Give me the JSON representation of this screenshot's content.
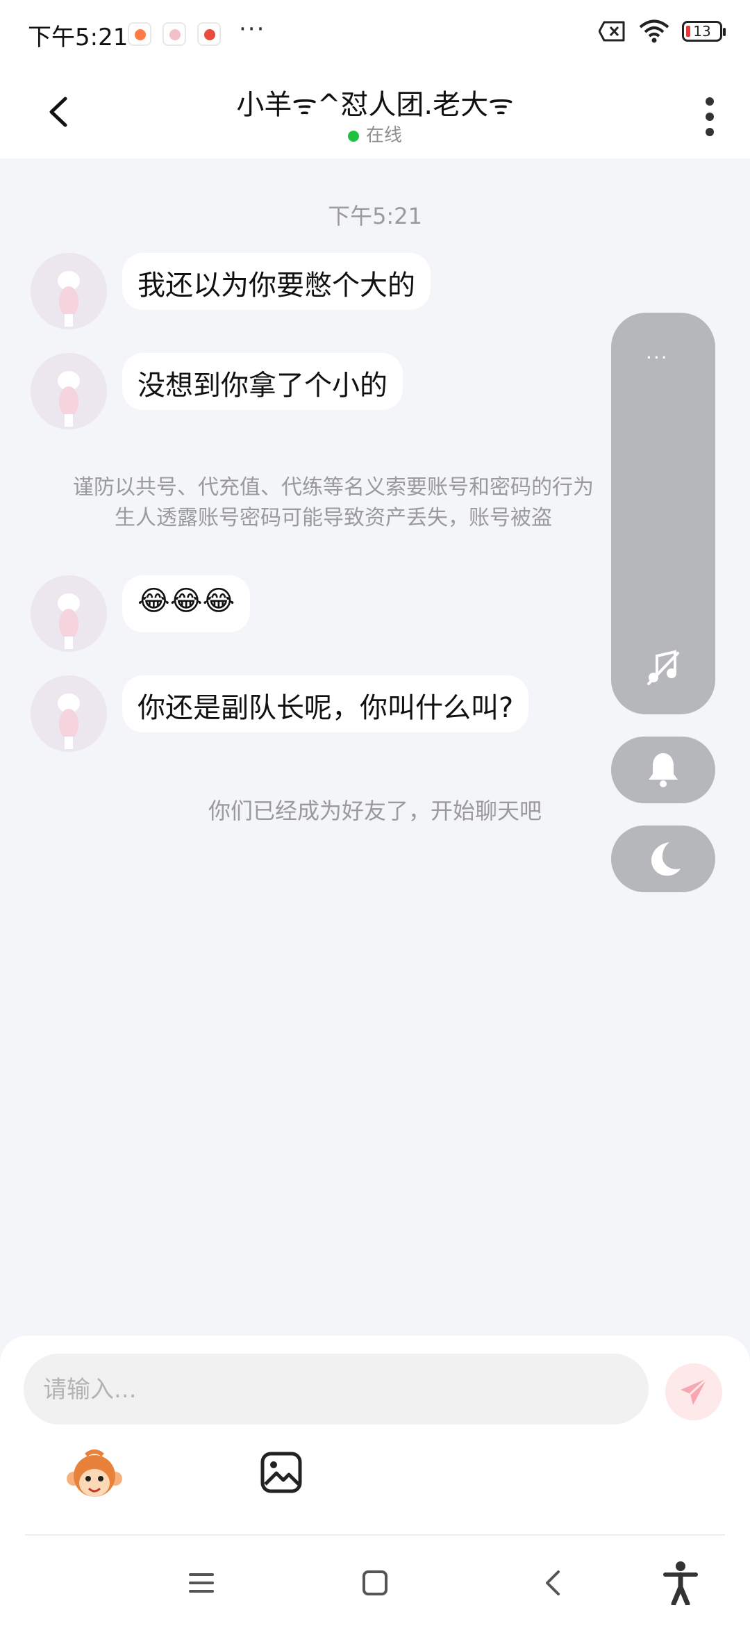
{
  "status": {
    "time": "下午5:21",
    "more": "···",
    "battery": "13"
  },
  "header": {
    "title": "小羊ᯤ^怼人团.老大ᯤ",
    "status": "在线"
  },
  "chat": {
    "timestamp": "下午5:21",
    "messages": [
      {
        "text": "我还以为你要憋个大的"
      },
      {
        "text": "没想到你拿了个小的"
      },
      {
        "text": "😂😂😂"
      },
      {
        "text": "你还是副队长呢，你叫什么叫?"
      }
    ],
    "notice_line1": "谨防以共号、代充值、代练等名义索要账号和密码的行为",
    "notice_line2": "生人透露账号密码可能导致资产丢失，账号被盗",
    "friend_note": "你们已经成为好友了，开始聊天吧"
  },
  "panel": {
    "more": "···"
  },
  "input": {
    "placeholder": "请输入..."
  },
  "colors": {
    "online": "#20c140",
    "panel": "#b6b7ba",
    "send_bg": "#fde8ea",
    "send_icon": "#f7a7b0"
  },
  "icons": {
    "back": "chevron-left-icon",
    "menu": "more-vertical-icon",
    "music": "music-off-icon",
    "bell": "bell-icon",
    "moon": "moon-icon",
    "send": "paper-plane-icon",
    "emoji": "monkey-emoji-icon",
    "image": "image-icon",
    "nav": [
      "menu-icon",
      "home-square-icon",
      "back-icon",
      "accessibility-icon"
    ]
  }
}
